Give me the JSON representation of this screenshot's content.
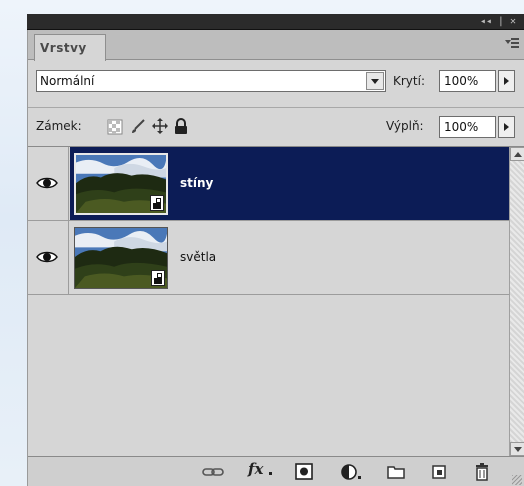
{
  "panel": {
    "tab_label": "Vrstvy",
    "menu_icon": "panel-menu-icon",
    "header_controls": "◂◂ | ✕"
  },
  "blend": {
    "mode": "Normální",
    "opacity_label": "Krytí:",
    "opacity_value": "100%"
  },
  "lock": {
    "label": "Zámek:",
    "icons": [
      "lock-transparent-icon",
      "lock-image-icon",
      "lock-position-icon",
      "lock-all-icon"
    ],
    "fill_label": "Výplň:",
    "fill_value": "100%"
  },
  "layers": [
    {
      "name": "stíny",
      "selected": true,
      "visible": true,
      "smart_object": true
    },
    {
      "name": "světla",
      "selected": false,
      "visible": true,
      "smart_object": true
    }
  ],
  "toolbar": {
    "icons": [
      "link-layers-icon",
      "layer-style-fx-icon",
      "add-mask-icon",
      "adjustment-layer-icon",
      "new-group-icon",
      "new-layer-icon",
      "delete-layer-icon"
    ],
    "fx_label": "fx"
  },
  "colors": {
    "selection": "#0c1c56",
    "panel_bg": "#d6d6d6",
    "tab_bar": "#bdbdbd"
  }
}
